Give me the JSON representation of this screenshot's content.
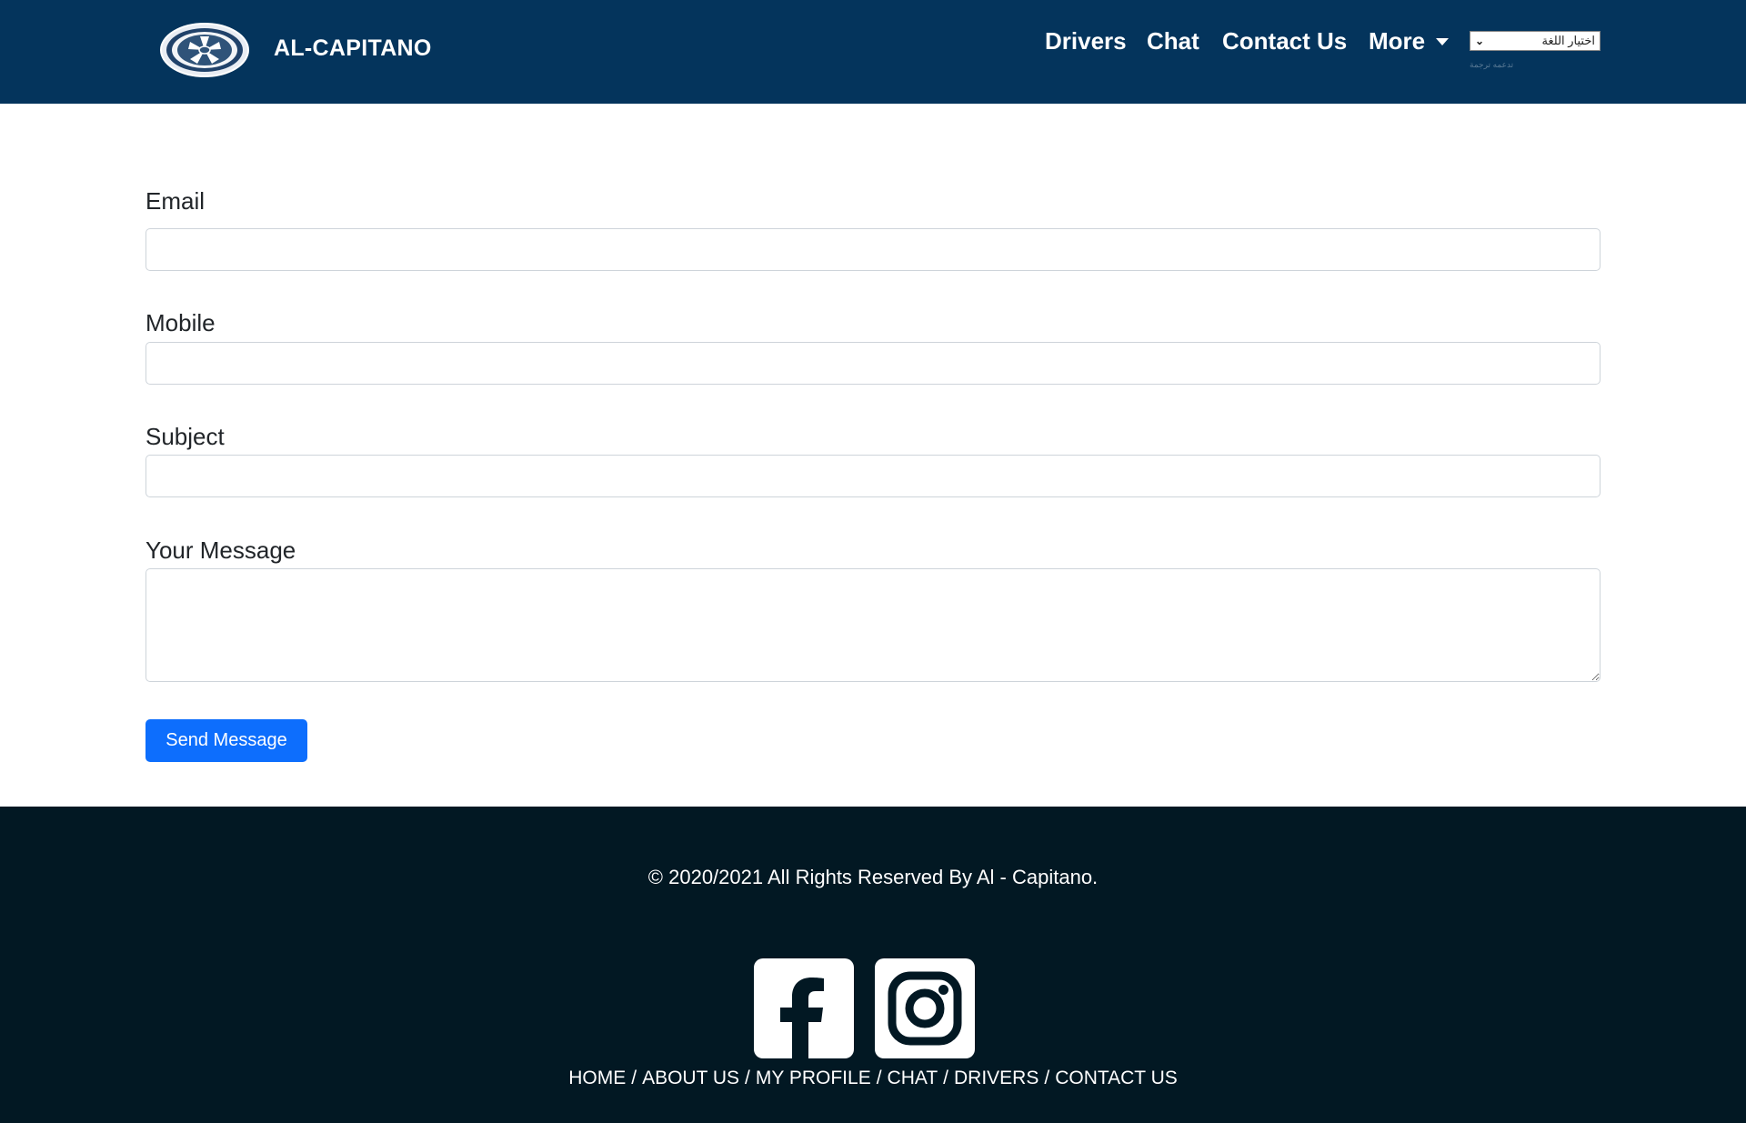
{
  "header": {
    "brand": "AL-CAPITANO",
    "nav": {
      "drivers": "Drivers",
      "chat": "Chat",
      "contact": "Contact Us",
      "more": "More"
    },
    "language_select": {
      "selected": "اختيار اللغة",
      "note": "تدعمه ترجمة"
    }
  },
  "form": {
    "email_label": "Email",
    "mobile_label": "Mobile",
    "subject_label": "Subject",
    "message_label": "Your Message",
    "email_value": "",
    "mobile_value": "",
    "subject_value": "",
    "message_value": "",
    "submit_label": "Send Message"
  },
  "footer": {
    "copyright": "© 2020/2021 All Rights Reserved By Al - Capitano.",
    "links": [
      "HOME",
      "ABOUT US",
      "MY PROFILE",
      "CHAT",
      "DRIVERS",
      "CONTACT US"
    ],
    "separator": "/",
    "social": [
      "facebook-icon",
      "instagram-icon"
    ]
  },
  "colors": {
    "navbar": "#04345c",
    "footer": "#021823",
    "button": "#0d6efd"
  }
}
